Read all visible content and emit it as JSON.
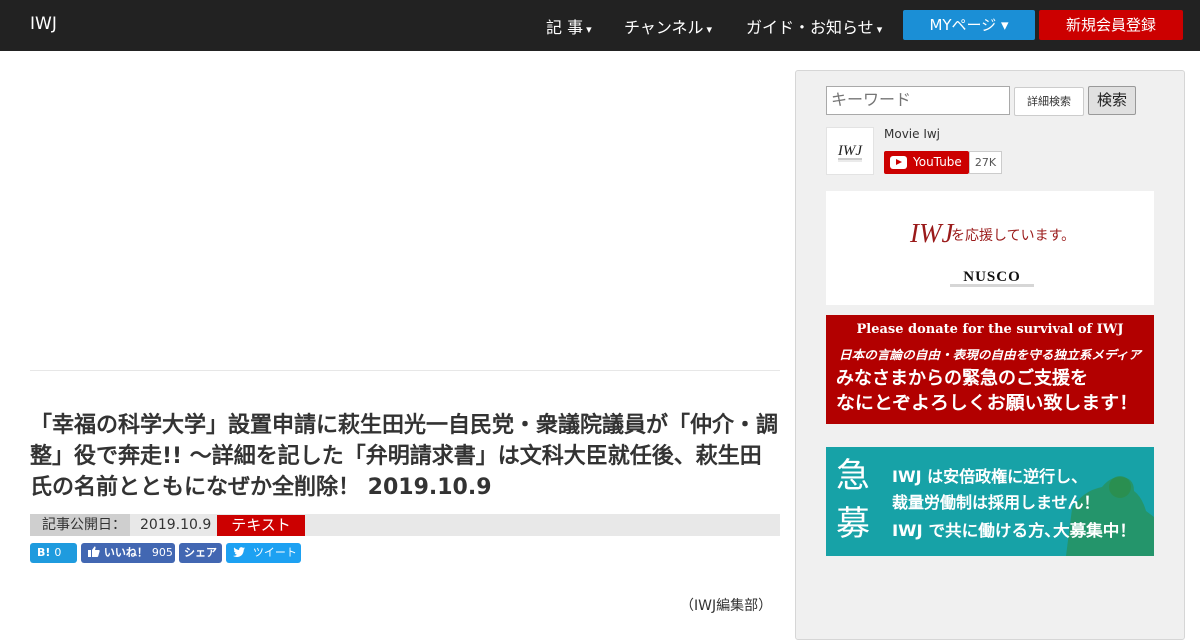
{
  "header": {
    "brand": "IWJ",
    "nav": [
      {
        "label": "記 事",
        "caret": "▾"
      },
      {
        "label": "チャンネル",
        "caret": "▾"
      },
      {
        "label": "ガイド・お知らせ",
        "caret": "▾"
      }
    ],
    "mypage_label": "MYページ ▾",
    "register_label": "新規会員登録",
    "colors": {
      "bar": "#222222",
      "mypage": "#1b8fd6",
      "register": "#cc0000"
    }
  },
  "article": {
    "title": "「幸福の科学大学」設置申請に萩生田光一自民党・衆議院議員が「仲介・調整」役で奔走!! ～詳細を記した「弁明請求書」は文科大臣就任後、萩生田氏の名前とともになぜか全削除！ 2019.10.9",
    "published_label": "記事公開日：",
    "published_date": "2019.10.9",
    "tag": "テキスト",
    "author": "（IWJ編集部）"
  },
  "share": {
    "hatena_label": "B!",
    "hatena_count": "0",
    "like_label": "いいね！",
    "like_count": "905",
    "share_label": "シェア",
    "tweet_label": "ツイート"
  },
  "sidebar": {
    "search_placeholder": "キーワード",
    "advanced_label": "詳細検索",
    "search_button": "検索",
    "channel_name": "Movie Iwj",
    "youtube_label": "YouTube",
    "subscriber_count": "27K",
    "banner_nusco": {
      "logo": "IWJ",
      "text": "を応援しています。",
      "sponsor": "NUSCO"
    },
    "banner_donate": {
      "line1": "Please donate for the survival of IWJ",
      "line2": "日本の言論の自由・表現の自由を守る独立系メディア",
      "line3": "みなさまからの緊急のご支援を",
      "line4": "なにとぞよろしくお願い致します！"
    },
    "banner_recruit": {
      "kanji1": "急",
      "kanji2": "募",
      "line1": "IWJ は安倍政権に逆行し、",
      "line2": "裁量労働制は採用しません！",
      "line3": "IWJ で共に働ける方､大募集中！"
    }
  }
}
